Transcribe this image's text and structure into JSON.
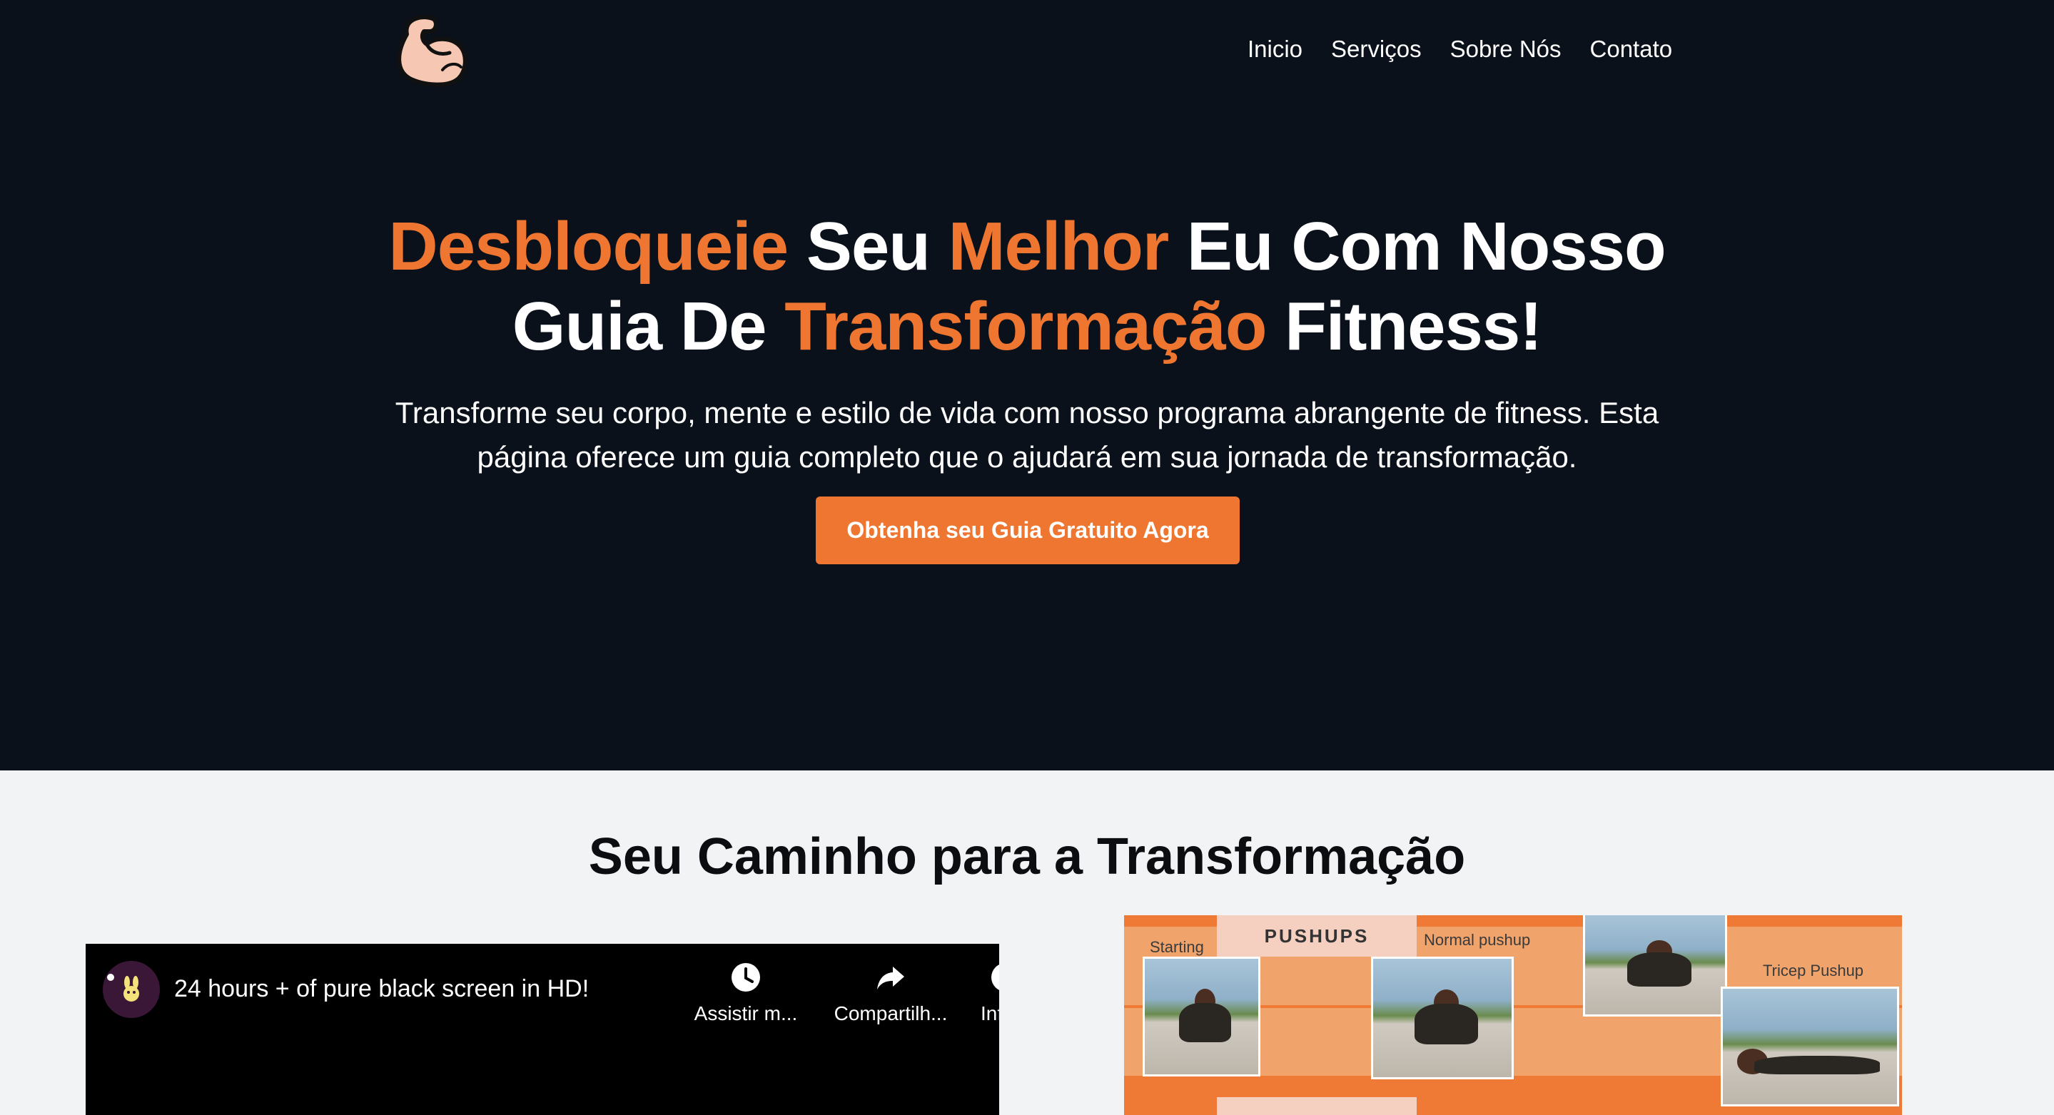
{
  "nav": {
    "items": [
      "Inicio",
      "Serviços",
      "Sobre Nós",
      "Contato"
    ]
  },
  "hero": {
    "title_line1": [
      {
        "text": "Desbloqueie",
        "highlight": true
      },
      {
        "text": " Seu ",
        "highlight": false
      },
      {
        "text": "Melhor",
        "highlight": true
      },
      {
        "text": " Eu Com Nosso",
        "highlight": false
      }
    ],
    "title_line2": [
      {
        "text": "Guia De ",
        "highlight": false
      },
      {
        "text": "Transformação",
        "highlight": true
      },
      {
        "text": " Fitness!",
        "highlight": false
      }
    ],
    "subtitle": "Transforme seu corpo, mente e estilo de vida com nosso programa abrangente de fitness. Esta página oferece um guia completo que o ajudará em sua jornada de transformação.",
    "cta_label": "Obtenha seu Guia Gratuito Agora"
  },
  "section": {
    "title": "Seu Caminho para a Transformação"
  },
  "video": {
    "title": "24 hours + of pure black screen in HD!",
    "watch_later": "Assistir m...",
    "share": "Compartilh...",
    "info": "Info..."
  },
  "pushups_image": {
    "heading": "PUSHUPS",
    "captions": {
      "starting": "Starting",
      "normal": "Normal pushup",
      "tricep": "Tricep Pushup"
    }
  },
  "colors": {
    "accent": "#ef7630",
    "dark_bg": "#0a111a",
    "light_bg": "#f2f3f5"
  },
  "icons": {
    "logo": "flexed-bicep-icon",
    "watch_later": "clock-icon",
    "share": "share-arrow-icon",
    "info": "info-icon"
  }
}
